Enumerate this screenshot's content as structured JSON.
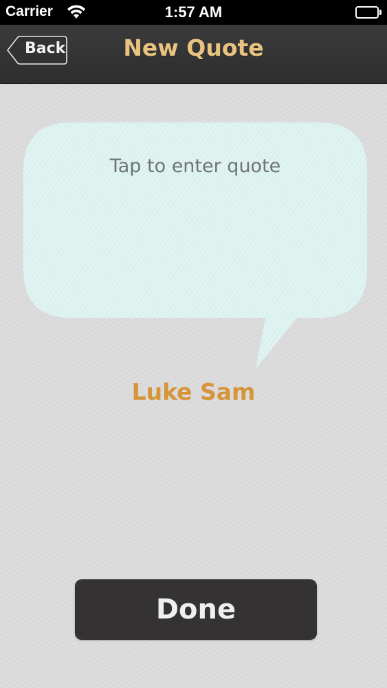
{
  "status_bar": {
    "carrier": "Carrier",
    "time": "1:57 AM",
    "wifi_icon": "wifi-icon",
    "battery_icon": "battery-icon",
    "battery_level": 1.0
  },
  "nav_bar": {
    "back_label": "Back",
    "title": "New Quote"
  },
  "quote": {
    "placeholder": "Tap to enter quote"
  },
  "author": {
    "name": "Luke Sam"
  },
  "actions": {
    "done_label": "Done"
  },
  "colors": {
    "nav_background": "#343334",
    "title_color": "#e8c480",
    "bubble_fill": "#dff3f1",
    "author_color": "#d6953a",
    "done_button_bg": "#343233",
    "page_background": "#dcdcdc"
  }
}
